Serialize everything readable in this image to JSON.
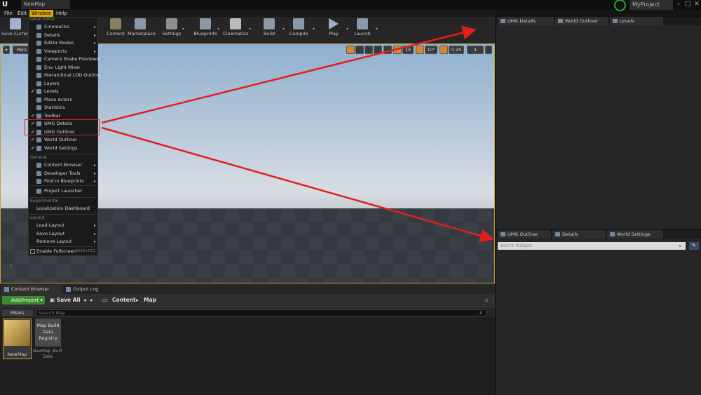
{
  "titlebar": {
    "logo": "U",
    "map_tab": "NewMap",
    "project": "MyProject",
    "min": "–",
    "max": "□",
    "close": "✕"
  },
  "menubar": [
    "File",
    "Edit",
    "Window",
    "Help"
  ],
  "toolbar": {
    "save_current": "Save Current",
    "content": "Content",
    "marketplace": "Marketplace",
    "settings": "Settings",
    "blueprints": "Blueprints",
    "cinematics": "Cinematics",
    "build": "Build",
    "compile": "Compile",
    "play": "Play",
    "launch": "Launch"
  },
  "viewport": {
    "perspective": "Pers",
    "snap_angle": "10°",
    "scale": "0.25",
    "cam_speed": "4",
    "axis": "Y"
  },
  "window_menu": {
    "sections": {
      "level_editor": "Level Editor",
      "general": "General",
      "experimental": "Experimental",
      "layout": "Layout"
    },
    "level_editor_items": [
      {
        "label": "Cinematics",
        "checked": false,
        "submenu": true
      },
      {
        "label": "Details",
        "checked": false,
        "submenu": true
      },
      {
        "label": "Editor Modes",
        "checked": false,
        "submenu": true
      },
      {
        "label": "Viewports",
        "checked": false,
        "submenu": true
      },
      {
        "label": "Camera Shake Previewer",
        "checked": false,
        "submenu": false
      },
      {
        "label": "Env. Light Mixer",
        "checked": false,
        "submenu": false
      },
      {
        "label": "Hierarchical LOD Outliner",
        "checked": false,
        "submenu": false
      },
      {
        "label": "Layers",
        "checked": false,
        "submenu": false
      },
      {
        "label": "Levels",
        "checked": true,
        "submenu": false
      },
      {
        "label": "Place Actors",
        "checked": false,
        "submenu": false
      },
      {
        "label": "Statistics",
        "checked": false,
        "submenu": false
      },
      {
        "label": "Toolbar",
        "checked": true,
        "submenu": false
      },
      {
        "label": "UMG Details",
        "checked": true,
        "submenu": false
      },
      {
        "label": "UMG Outliner",
        "checked": true,
        "submenu": false
      },
      {
        "label": "World Outliner",
        "checked": true,
        "submenu": false
      },
      {
        "label": "World Settings",
        "checked": true,
        "submenu": false
      }
    ],
    "general_items": [
      {
        "label": "Content Browser",
        "submenu": true
      },
      {
        "label": "Developer Tools",
        "submenu": true
      },
      {
        "label": "Find in Blueprints",
        "submenu": true
      },
      {
        "label": "Project Launcher",
        "submenu": false
      }
    ],
    "experimental_items": [
      {
        "label": "Localization Dashboard"
      }
    ],
    "layout_items": [
      {
        "label": "Load Layout",
        "submenu": true
      },
      {
        "label": "Save Layout",
        "submenu": true
      },
      {
        "label": "Remove Layout",
        "submenu": true
      }
    ],
    "fullscreen": {
      "label": "Enable Fullscreen",
      "shortcut": "Shift+F11"
    }
  },
  "content_browser": {
    "tabs": [
      "Content Browser",
      "Output Log"
    ],
    "add_import": "Add/Import",
    "save_all": "Save All",
    "breadcrumb": [
      "Content",
      "Map"
    ],
    "filters": "Filters",
    "search_placeholder": "Search Map",
    "assets": [
      {
        "name": "NewMap"
      },
      {
        "name": "Map Build Data Registry",
        "caption": "NewMap_Built Data"
      }
    ]
  },
  "right_top_tabs": [
    "UMG Details",
    "World Outliner",
    "Levels"
  ],
  "right_bottom_tabs": [
    "UMG Outliner",
    "Details",
    "World Settings"
  ],
  "umg_outliner": {
    "search_placeholder": "Search Widgets"
  },
  "colors": {
    "accent": "#d4a30d",
    "highlight": "#e02020",
    "add_button": "#3c8a2e"
  }
}
